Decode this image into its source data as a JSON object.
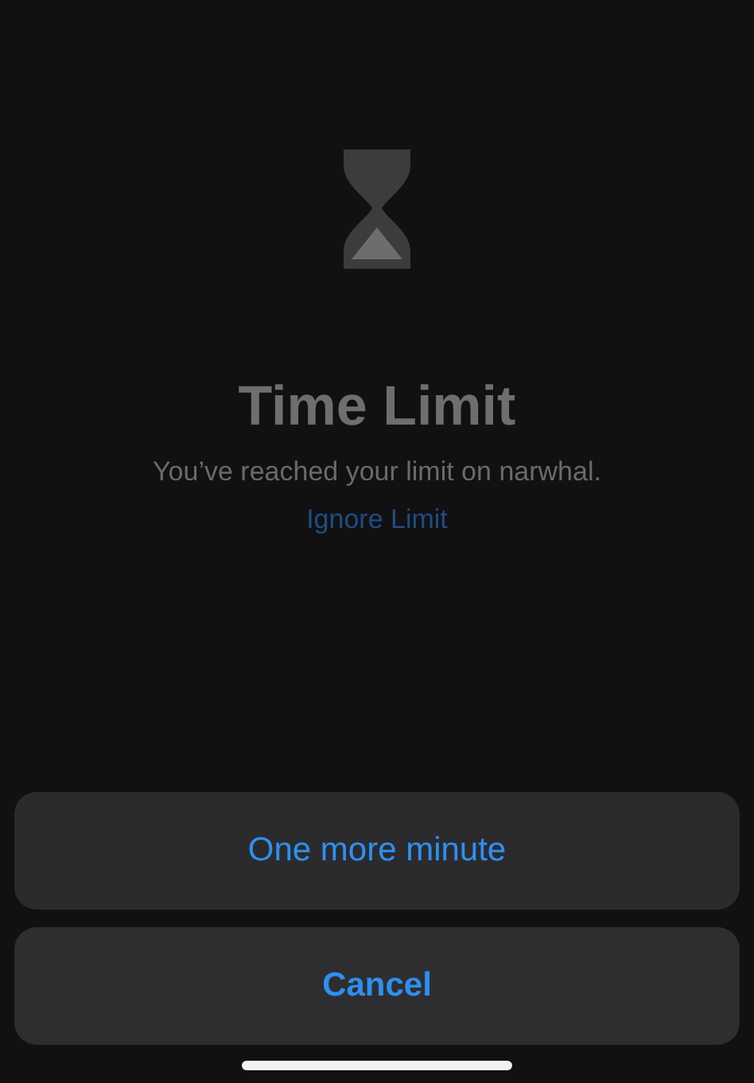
{
  "alert": {
    "title": "Time Limit",
    "message": "You’ve reached your limit on narwhal.",
    "link": "Ignore Limit"
  },
  "action_sheet": {
    "actions": [
      {
        "label": "One more minute",
        "kind": "default"
      },
      {
        "label": "Cancel",
        "kind": "cancel"
      }
    ]
  }
}
